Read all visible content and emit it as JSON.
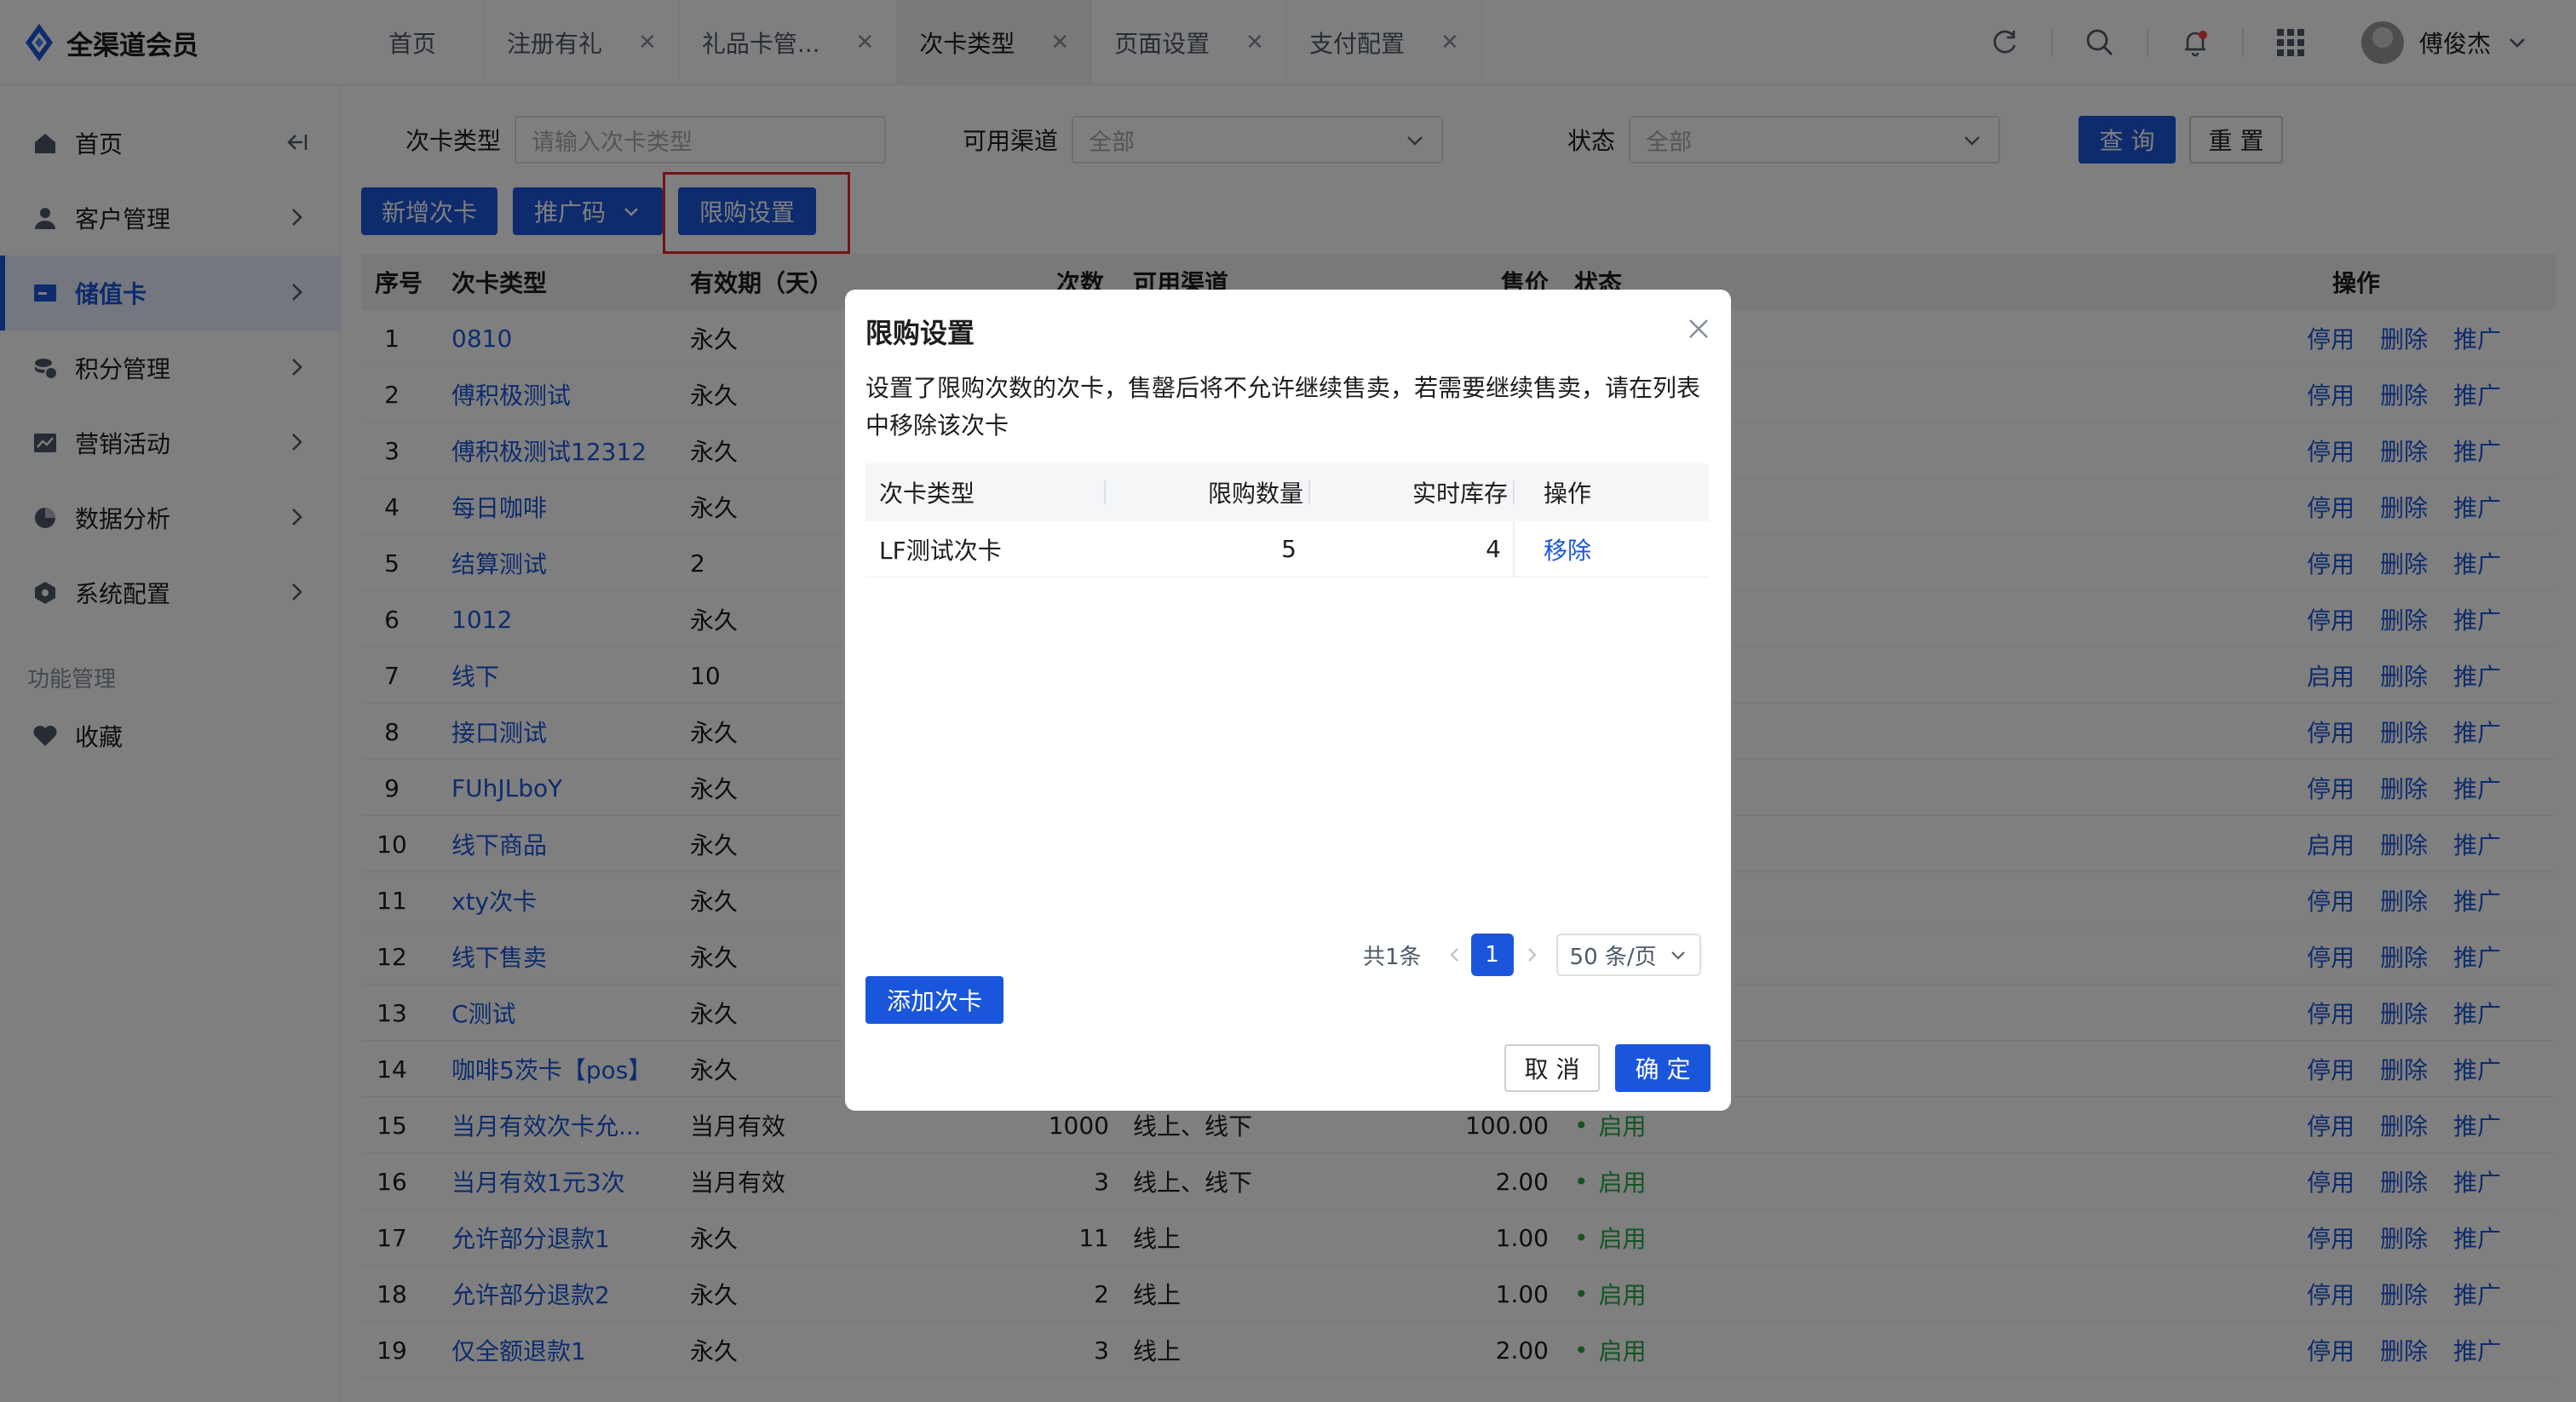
{
  "app": {
    "title": "全渠道会员"
  },
  "tabs": [
    {
      "label": "首页",
      "closable": false,
      "active": false
    },
    {
      "label": "注册有礼",
      "closable": true,
      "active": false
    },
    {
      "label": "礼品卡管...",
      "closable": true,
      "active": false
    },
    {
      "label": "次卡类型",
      "closable": true,
      "active": true
    },
    {
      "label": "页面设置",
      "closable": true,
      "active": false
    },
    {
      "label": "支付配置",
      "closable": true,
      "active": false
    }
  ],
  "user": {
    "name": "傅俊杰"
  },
  "sidebar": {
    "items": [
      {
        "label": "首页",
        "icon": "home-icon"
      },
      {
        "label": "客户管理",
        "icon": "user-icon"
      },
      {
        "label": "储值卡",
        "icon": "card-icon",
        "active": true
      },
      {
        "label": "积分管理",
        "icon": "coins-icon"
      },
      {
        "label": "营销活动",
        "icon": "chart-line-icon"
      },
      {
        "label": "数据分析",
        "icon": "pie-chart-icon"
      },
      {
        "label": "系统配置",
        "icon": "settings-hex-icon"
      }
    ],
    "section_title": "功能管理",
    "favorites_label": "收藏"
  },
  "filters": {
    "card_type_label": "次卡类型",
    "card_type_placeholder": "请输入次卡类型",
    "channel_label": "可用渠道",
    "channel_value": "全部",
    "status_label": "状态",
    "status_value": "全部",
    "query_label": "查 询",
    "reset_label": "重 置"
  },
  "toolbar": {
    "add_label": "新增次卡",
    "promo_label": "推广码",
    "limit_label": "限购设置"
  },
  "table": {
    "headers": {
      "index": "序号",
      "type": "次卡类型",
      "validity": "有效期（天）",
      "count": "次数",
      "channel": "可用渠道",
      "price": "售价",
      "status": "状态",
      "ops": "操作"
    },
    "op_delete": "删除",
    "op_promote": "推广",
    "rows": [
      {
        "idx": "1",
        "name": "0810",
        "validity": "永久",
        "count": "",
        "channel": "",
        "price": "",
        "status": "",
        "toggle": "停用"
      },
      {
        "idx": "2",
        "name": "傅积极测试",
        "validity": "永久",
        "count": "",
        "channel": "",
        "price": "",
        "status": "",
        "toggle": "停用"
      },
      {
        "idx": "3",
        "name": "傅积极测试12312",
        "validity": "永久",
        "count": "",
        "channel": "",
        "price": "",
        "status": "",
        "toggle": "停用"
      },
      {
        "idx": "4",
        "name": "每日咖啡",
        "validity": "永久",
        "count": "",
        "channel": "",
        "price": "",
        "status": "",
        "toggle": "停用"
      },
      {
        "idx": "5",
        "name": "结算测试",
        "validity": "2",
        "count": "",
        "channel": "",
        "price": "",
        "status": "",
        "toggle": "停用"
      },
      {
        "idx": "6",
        "name": "1012",
        "validity": "永久",
        "count": "",
        "channel": "",
        "price": "",
        "status": "",
        "toggle": "停用"
      },
      {
        "idx": "7",
        "name": "线下",
        "validity": "10",
        "count": "",
        "channel": "",
        "price": "",
        "status": "",
        "toggle": "启用"
      },
      {
        "idx": "8",
        "name": "接口测试",
        "validity": "永久",
        "count": "",
        "channel": "",
        "price": "",
        "status": "",
        "toggle": "停用"
      },
      {
        "idx": "9",
        "name": "FUhJLboY",
        "validity": "永久",
        "count": "",
        "channel": "",
        "price": "",
        "status": "",
        "toggle": "停用"
      },
      {
        "idx": "10",
        "name": "线下商品",
        "validity": "永久",
        "count": "",
        "channel": "",
        "price": "",
        "status": "",
        "toggle": "启用"
      },
      {
        "idx": "11",
        "name": "xty次卡",
        "validity": "永久",
        "count": "",
        "channel": "",
        "price": "",
        "status": "",
        "toggle": "停用"
      },
      {
        "idx": "12",
        "name": "线下售卖",
        "validity": "永久",
        "count": "",
        "channel": "",
        "price": "",
        "status": "",
        "toggle": "停用"
      },
      {
        "idx": "13",
        "name": "C测试",
        "validity": "永久",
        "count": "",
        "channel": "",
        "price": "",
        "status": "",
        "toggle": "停用"
      },
      {
        "idx": "14",
        "name": "咖啡5茨卡【pos】",
        "validity": "永久",
        "count": "",
        "channel": "",
        "price": "",
        "status": "",
        "toggle": "停用"
      },
      {
        "idx": "15",
        "name": "当月有效次卡允...",
        "validity": "当月有效",
        "count": "1000",
        "channel": "线上、线下",
        "price": "100.00",
        "status": "启用",
        "toggle": "停用"
      },
      {
        "idx": "16",
        "name": "当月有效1元3次",
        "validity": "当月有效",
        "count": "3",
        "channel": "线上、线下",
        "price": "2.00",
        "status": "启用",
        "toggle": "停用"
      },
      {
        "idx": "17",
        "name": "允许部分退款1",
        "validity": "永久",
        "count": "11",
        "channel": "线上",
        "price": "1.00",
        "status": "启用",
        "toggle": "停用"
      },
      {
        "idx": "18",
        "name": "允许部分退款2",
        "validity": "永久",
        "count": "2",
        "channel": "线上",
        "price": "1.00",
        "status": "启用",
        "toggle": "停用"
      },
      {
        "idx": "19",
        "name": "仅全额退款1",
        "validity": "永久",
        "count": "3",
        "channel": "线上",
        "price": "2.00",
        "status": "启用",
        "toggle": "停用"
      }
    ]
  },
  "modal": {
    "title": "限购设置",
    "description": "设置了限购次数的次卡，售罄后将不允许继续售卖，若需要继续售卖，请在列表中移除该次卡",
    "headers": {
      "type": "次卡类型",
      "limit": "限购数量",
      "stock": "实时库存",
      "ops": "操作"
    },
    "rows": [
      {
        "type": "LF测试次卡",
        "limit": "5",
        "stock": "4",
        "action": "移除"
      }
    ],
    "pagination": {
      "total": "共1条",
      "page": "1",
      "page_size": "50 条/页"
    },
    "add_label": "添加次卡",
    "cancel_label": "取 消",
    "confirm_label": "确 定"
  },
  "colors": {
    "primary": "#1a56db",
    "success": "#27a844",
    "highlight": "#e6262a"
  }
}
